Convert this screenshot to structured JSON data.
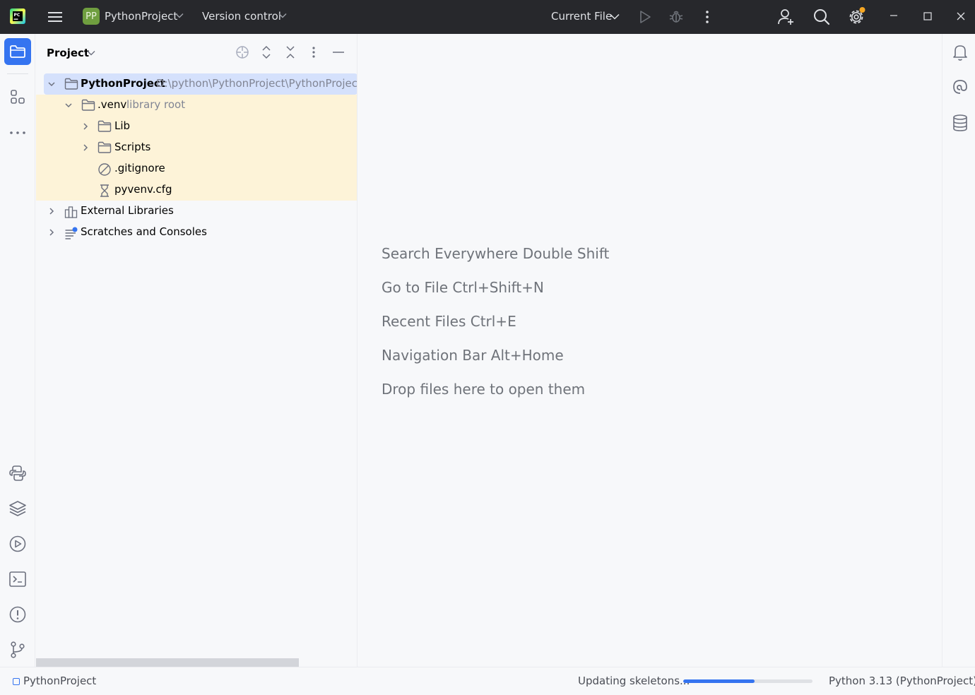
{
  "titlebar": {
    "project_badge": "PP",
    "project_name": "PythonProject",
    "version_control": "Version control",
    "run_config": "Current File"
  },
  "project_panel": {
    "title": "Project",
    "tree": [
      {
        "label": "PythonProject",
        "hint": "D:\\python\\PythonProject\\PythonProject\\PythonProject",
        "icon": "folder-icon",
        "expanded": true,
        "depth": 0
      },
      {
        "label": ".venv",
        "hint": "library root",
        "icon": "folder-icon",
        "expanded": true,
        "depth": 1
      },
      {
        "label": "Lib",
        "hint": "",
        "icon": "folder-icon",
        "expanded": false,
        "depth": 2
      },
      {
        "label": "Scripts",
        "hint": "",
        "icon": "folder-icon",
        "expanded": false,
        "depth": 2
      },
      {
        "label": ".gitignore",
        "hint": "",
        "icon": "ignored-file-icon",
        "depth": 2
      },
      {
        "label": "pyvenv.cfg",
        "hint": "",
        "icon": "config-file-icon",
        "depth": 2
      },
      {
        "label": "External Libraries",
        "hint": "",
        "icon": "libraries-icon",
        "expanded": false,
        "depth": 0
      },
      {
        "label": "Scratches and Consoles",
        "hint": "",
        "icon": "scratches-icon",
        "expanded": false,
        "depth": 0
      }
    ]
  },
  "editor": {
    "hints": [
      "Search Everywhere Double Shift",
      "Go to File Ctrl+Shift+N",
      "Recent Files Ctrl+E",
      "Navigation Bar Alt+Home",
      "Drop files here to open them"
    ]
  },
  "statusbar": {
    "project": "PythonProject",
    "task": "Updating skeletons...",
    "progress": 0.55,
    "interpreter": "Python 3.13 (PythonProject)"
  },
  "colors": {
    "accent": "#3574f0",
    "titlebar_bg": "#27282c",
    "highlight_row": "#fdf3d8",
    "selected_row": "#d5e1fc",
    "gear_badge": "#f5a623"
  }
}
